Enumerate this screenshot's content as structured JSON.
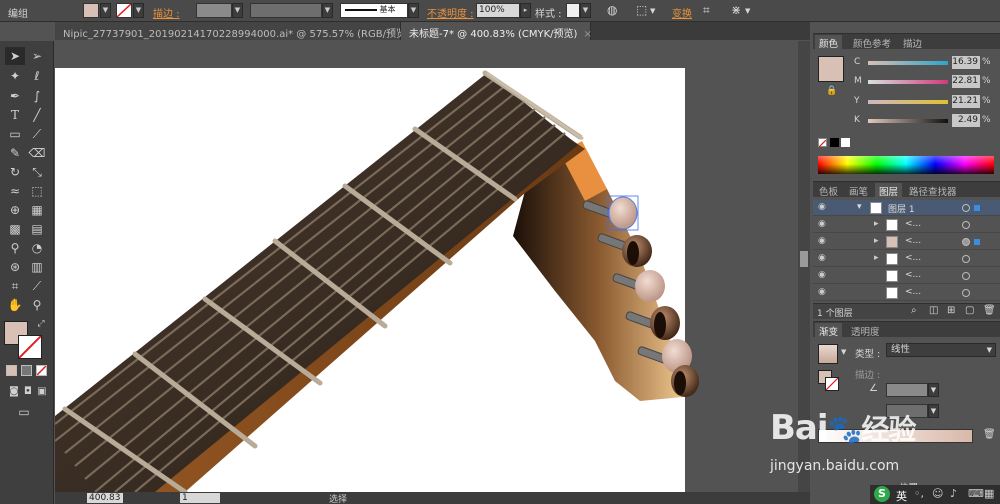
{
  "control_bar": {
    "group_label": "编组",
    "stroke_label": "描边 :",
    "stroke_style_label": "基本",
    "opacity_label": "不透明度 :",
    "opacity_value": "100%",
    "style_label": "样式 :",
    "transform_label": "变换"
  },
  "tabs": [
    {
      "label": "Nipic_27737901_20190214170228994000.ai* @ 575.57% (RGB/预览)",
      "close": "×"
    },
    {
      "label": "未标题-7* @ 400.83% (CMYK/预览)",
      "close": "×"
    }
  ],
  "status": {
    "zoom": "400.83",
    "page": "1",
    "tool": "选择"
  },
  "color_panel": {
    "tabs": [
      "颜色",
      "颜色参考",
      "描边"
    ],
    "channels": [
      {
        "name": "C",
        "value": "16.39",
        "unit": "%"
      },
      {
        "name": "M",
        "value": "22.81",
        "unit": "%"
      },
      {
        "name": "Y",
        "value": "21.21",
        "unit": "%"
      },
      {
        "name": "K",
        "value": "2.49",
        "unit": "%"
      }
    ],
    "fill_color": "#d9c0b4"
  },
  "layers_panel": {
    "tabs": [
      "色板",
      "画笔",
      "图层",
      "路径查找器"
    ],
    "layer_name": "图层 1",
    "sublayer_label": "<...",
    "footer_label": "1 个图层"
  },
  "gradient_panel": {
    "tabs": [
      "渐变",
      "透明度"
    ],
    "type_label": "类型 :",
    "type_value": "线性",
    "stroke_label": "描边 :",
    "position_label": "位置"
  },
  "watermark": {
    "brand": "Bai",
    "brand2": "经验",
    "url": "jingyan.baidu.com"
  },
  "taskbar": {
    "ime": "英"
  }
}
